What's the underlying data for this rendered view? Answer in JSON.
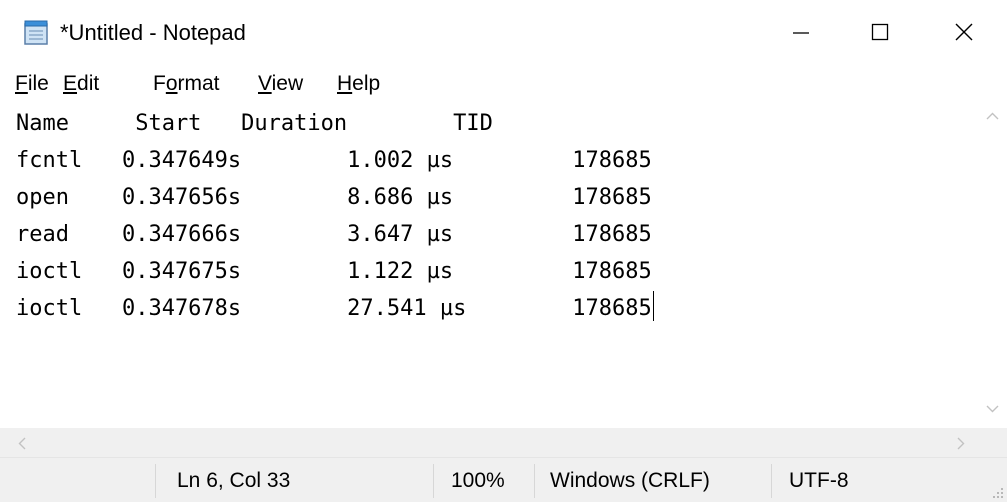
{
  "window": {
    "title": "*Untitled - Notepad"
  },
  "menu": {
    "file": {
      "accel": "F",
      "rest": "ile"
    },
    "edit": {
      "accel": "E",
      "rest": "dit"
    },
    "format": {
      "pre": "F",
      "accel": "o",
      "rest": "rmat"
    },
    "view": {
      "accel": "V",
      "rest": "iew"
    },
    "help": {
      "accel": "H",
      "rest": "elp"
    }
  },
  "editor": {
    "lines": [
      "Name     Start   Duration        TID",
      "fcntl   0.347649s        1.002 µs         178685",
      "open    0.347656s        8.686 µs         178685",
      "read    0.347666s        3.647 µs         178685",
      "ioctl   0.347675s        1.122 µs         178685",
      "ioctl   0.347678s        27.541 µs        178685"
    ]
  },
  "statusbar": {
    "position": "Ln 6, Col 33",
    "zoom": "100%",
    "line_ending": "Windows (CRLF)",
    "encoding": "UTF-8"
  },
  "icons": {
    "app": "notepad-icon",
    "minimize": "minimize-icon",
    "maximize": "maximize-icon",
    "close": "close-icon"
  }
}
